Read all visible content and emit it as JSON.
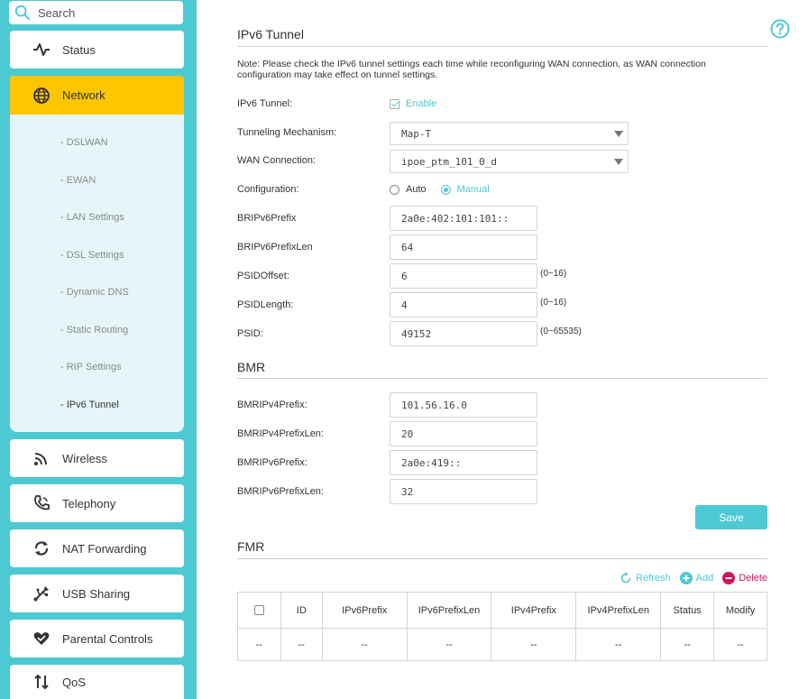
{
  "search": {
    "placeholder": "Search"
  },
  "sidebar": {
    "items": [
      {
        "label": "Status",
        "icon": "pulse-icon"
      },
      {
        "label": "Network",
        "icon": "globe-icon"
      },
      {
        "label": "Wireless",
        "icon": "wifi-icon"
      },
      {
        "label": "Telephony",
        "icon": "phone-icon"
      },
      {
        "label": "NAT Forwarding",
        "icon": "nat-icon"
      },
      {
        "label": "USB Sharing",
        "icon": "usb-icon"
      },
      {
        "label": "Parental Controls",
        "icon": "heart-icon"
      },
      {
        "label": "QoS",
        "icon": "qos-icon"
      }
    ],
    "network_sub": [
      "- DSLWAN",
      "- EWAN",
      "- LAN Settings",
      "- DSL Settings",
      "- Dynamic DNS",
      "- Static Routing",
      "- RIP Settings",
      "- IPv6 Tunnel"
    ]
  },
  "colors": {
    "accent": "#4dc9d3",
    "active_nav": "#ffc600",
    "delete": "#c8175d"
  },
  "ipv6": {
    "title": "IPv6 Tunnel",
    "note": "Note: Please check the IPv6 tunnel settings each time while reconfiguring WAN connection, as WAN connection configuration may take effect on tunnel settings.",
    "tunnel_label": "IPv6 Tunnel:",
    "enable_label": "Enable",
    "mechanism_label": "Tunneling Mechanism:",
    "mechanism_value": "Map-T",
    "wan_label": "WAN Connection:",
    "wan_value": "ipoe_ptm_101_0_d",
    "config_label": "Configuration:",
    "auto_label": "Auto",
    "manual_label": "Manual",
    "fields": [
      {
        "label": "BRIPv6Prefix",
        "value": "2a0e:402:101:101::",
        "hint": ""
      },
      {
        "label": "BRIPv6PrefixLen",
        "value": "64",
        "hint": ""
      },
      {
        "label": "PSIDOffset:",
        "value": "6",
        "hint": "(0~16)"
      },
      {
        "label": "PSIDLength:",
        "value": "4",
        "hint": "(0~16)"
      },
      {
        "label": "PSID:",
        "value": "49152",
        "hint": "(0~65535)"
      }
    ]
  },
  "bmr": {
    "title": "BMR",
    "fields": [
      {
        "label": "BMRIPv4Prefix:",
        "value": "101.56.16.0"
      },
      {
        "label": "BMRIPv4PrefixLen:",
        "value": "20"
      },
      {
        "label": "BMRIPv6Prefix:",
        "value": "2a0e:419::"
      },
      {
        "label": "BMRIPv6PrefixLen:",
        "value": "32"
      }
    ],
    "save_label": "Save"
  },
  "fmr": {
    "title": "FMR",
    "refresh_label": "Refresh",
    "add_label": "Add",
    "delete_label": "Delete",
    "columns": [
      "ID",
      "IPv6Prefix",
      "IPv6PrefixLen",
      "IPv4Prefix",
      "IPv4PrefixLen",
      "Status",
      "Modify"
    ],
    "rows": [
      [
        "--",
        "--",
        "--",
        "--",
        "--",
        "--",
        "--",
        "--"
      ]
    ]
  }
}
